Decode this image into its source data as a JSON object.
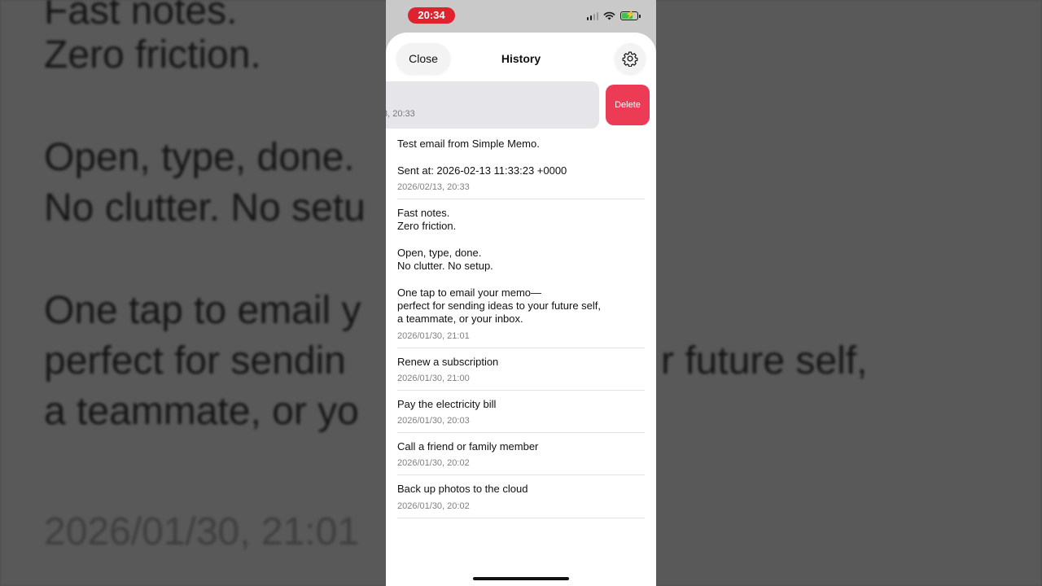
{
  "background_zoom": {
    "lines": [
      "Fast notes.",
      "Zero friction.",
      "Open, type, done.",
      "No clutter. No setu",
      "One tap to email y",
      "perfect for sendin",
      "r future self,",
      "a teammate, or yo"
    ],
    "timestamp": "2026/01/30, 21:01"
  },
  "status_bar": {
    "time": "20:34",
    "icons": [
      "signal-icon",
      "wifi-icon",
      "battery-charging-icon"
    ]
  },
  "nav": {
    "close_label": "Close",
    "title": "History",
    "settings_icon": "gear-icon"
  },
  "swiped_row": {
    "timestamp_partial": "3, 20:33",
    "delete_label": "Delete"
  },
  "items": [
    {
      "text": "Test email from Simple Memo.\n\nSent at: 2026-02-13 11:33:23 +0000",
      "timestamp": "2026/02/13, 20:33"
    },
    {
      "text": "Fast notes.\nZero friction.\n\nOpen, type, done.\nNo clutter. No setup.\n\nOne tap to email your memo—\nperfect for sending ideas to your future self,\na teammate, or your inbox.\n",
      "timestamp": "2026/01/30, 21:01"
    },
    {
      "text": "Renew a subscription",
      "timestamp": "2026/01/30, 21:00"
    },
    {
      "text": "Pay the electricity bill",
      "timestamp": "2026/01/30, 20:03"
    },
    {
      "text": "Call a friend or family member",
      "timestamp": "2026/01/30, 20:02"
    },
    {
      "text": "Back up photos to the cloud",
      "timestamp": "2026/01/30, 20:02"
    }
  ],
  "colors": {
    "time_pill": "#e0212e",
    "delete": "#ec3b54",
    "battery_fill": "#3fc24a"
  }
}
